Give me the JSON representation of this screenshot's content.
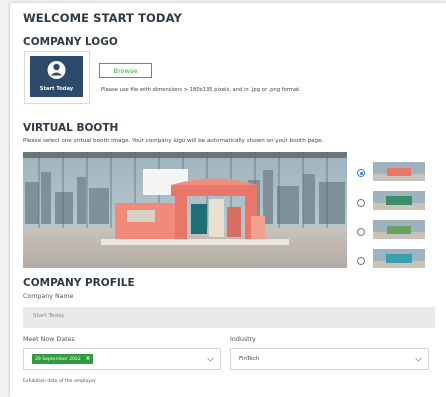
{
  "page_title": "WELCOME START TODAY",
  "company_logo": {
    "heading": "COMPANY LOGO",
    "logo_text": "Start Today",
    "browse_label": "Browse",
    "hint": "Please use file with dimensions > 180x135 pixels, and in .jpg or .png format."
  },
  "virtual_booth": {
    "heading": "VIRTUAL BOOTH",
    "description": "Please select one virtual booth image. Your company logo will be automatically shown on your booth page.",
    "options": [
      {
        "thumb_color": "#e8776a",
        "selected": true
      },
      {
        "thumb_color": "#3a8f6a",
        "selected": false
      },
      {
        "thumb_color": "#6aa060",
        "selected": false
      },
      {
        "thumb_color": "#3aa0b0",
        "selected": false
      }
    ]
  },
  "company_profile": {
    "heading": "COMPANY PROFILE",
    "company_name_label": "Company Name",
    "company_name_value": "Start Today",
    "dates_label": "Meet Now Dates",
    "date_chip": "29 September 2022",
    "date_chip_remove": "×",
    "industry_label": "Industry",
    "industry_value": "FinTech",
    "footnote": "Exhibition date of the employer"
  },
  "colors": {
    "accent_green": "#3eaa4a",
    "radio_blue": "#2f80ed",
    "booth_salmon": "#e8776a",
    "logo_navy": "#2d4a6b"
  }
}
